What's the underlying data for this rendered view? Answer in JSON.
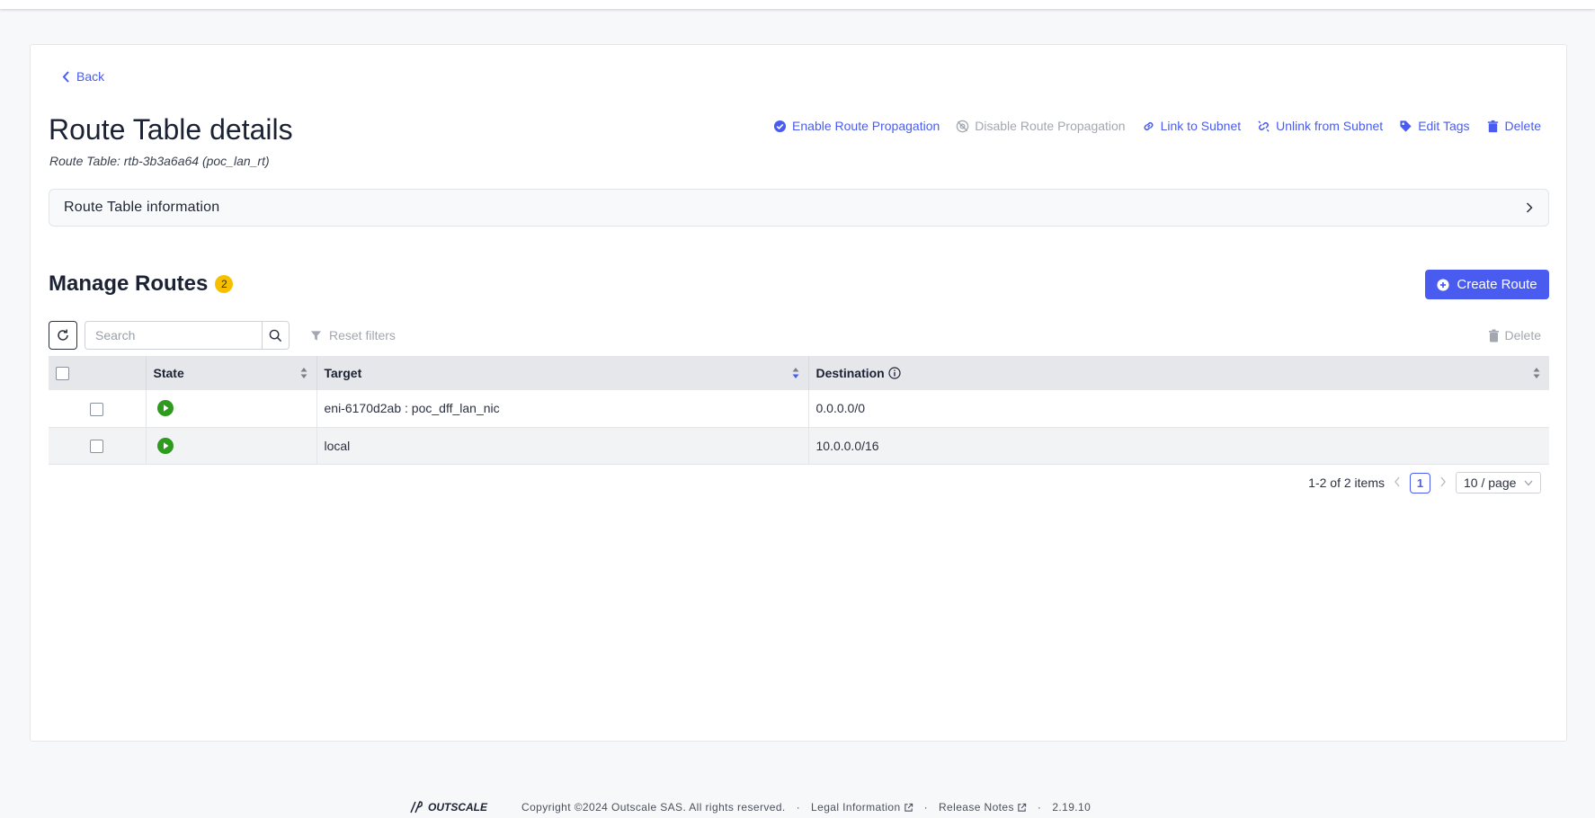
{
  "nav": {
    "back_label": "Back"
  },
  "header": {
    "title": "Route Table details",
    "subtitle": "Route Table: rtb-3b3a6a64 (poc_lan_rt)"
  },
  "actions": {
    "enable_propagation": "Enable Route Propagation",
    "disable_propagation": "Disable Route Propagation",
    "link_subnet": "Link to Subnet",
    "unlink_subnet": "Unlink from Subnet",
    "edit_tags": "Edit Tags",
    "delete": "Delete"
  },
  "info_panel": {
    "label": "Route Table information"
  },
  "routes": {
    "title": "Manage Routes",
    "count": "2",
    "create_label": "Create Route",
    "search_placeholder": "Search",
    "reset_filters": "Reset filters",
    "delete_label": "Delete",
    "columns": {
      "state": "State",
      "target": "Target",
      "destination": "Destination"
    },
    "rows": [
      {
        "state": "active",
        "target": "eni-6170d2ab : poc_dff_lan_nic",
        "destination": "0.0.0.0/0"
      },
      {
        "state": "active",
        "target": "local",
        "destination": "10.0.0.0/16"
      }
    ]
  },
  "pagination": {
    "summary": "1-2 of 2 items",
    "current_page": "1",
    "page_size": "10 / page"
  },
  "footer": {
    "brand": "OUTSCALE",
    "copyright": "Copyright ©2024 Outscale SAS. All rights reserved.",
    "legal": "Legal Information",
    "release_notes": "Release Notes",
    "version": "2.19.10"
  },
  "colors": {
    "accent": "#4a5cf0",
    "badge": "#f6c000",
    "state_active": "#2e9a1e"
  }
}
